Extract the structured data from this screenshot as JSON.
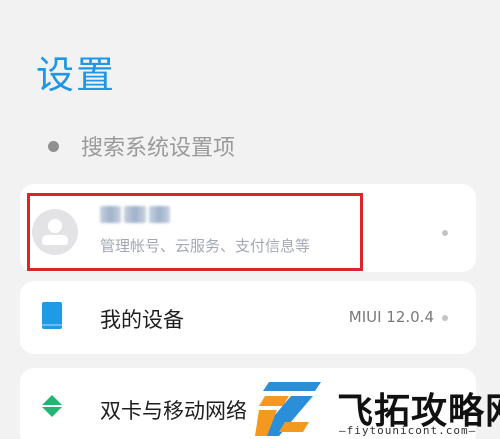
{
  "header": {
    "title": "设置"
  },
  "search": {
    "placeholder": "搜索系统设置项"
  },
  "account": {
    "subtitle": "管理帐号、云服务、支付信息等"
  },
  "device": {
    "label": "我的设备",
    "version": "MIUI 12.0.4"
  },
  "sim": {
    "label": "双卡与移动网络"
  },
  "watermark": {
    "title": "飞拓攻略网",
    "url": "—fiytounicont.com—"
  },
  "colors": {
    "accent": "#1f96e6",
    "highlight": "#d8262a",
    "sim_icon": "#22b573",
    "watermark_orange": "#f39a1e",
    "watermark_blue": "#2a8fd8"
  }
}
